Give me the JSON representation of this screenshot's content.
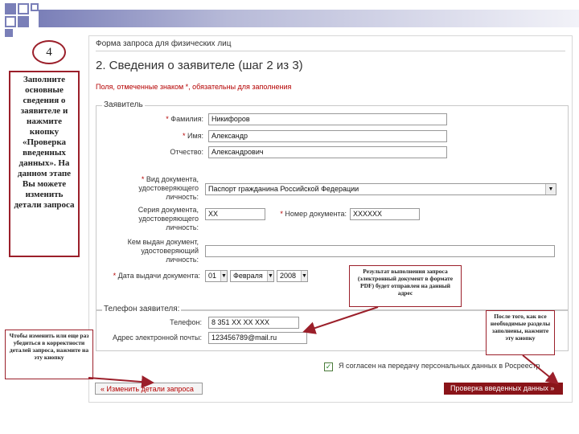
{
  "step_number": "4",
  "left_instruction": "Заполните основные сведения о заявителе и нажмите кнопку «Проверка введенных данных». На данном этапе Вы можете изменить детали запроса",
  "form": {
    "breadcrumb": "Форма запроса для физических лиц",
    "heading": "2. Сведения о заявителе (шаг 2 из 3)",
    "required_note": "Поля, отмеченные знаком *, обязательны для заполнения"
  },
  "applicant": {
    "legend": "Заявитель",
    "surname_label": "Фамилия:",
    "surname_value": "Никифоров",
    "name_label": "Имя:",
    "name_value": "Александр",
    "patronymic_label": "Отчество:",
    "patronymic_value": "Александрович",
    "doc_type_label_line1": "Вид документа,",
    "doc_type_label_line2": "удостоверяющего",
    "doc_type_label_line3": "личность:",
    "doc_type_value": "Паспорт гражданина Российской Федерации",
    "doc_series_label_line1": "Серия документа,",
    "doc_series_label_line2": "удостоверяющего",
    "doc_series_label_line3": "личность:",
    "doc_series_value": "XX",
    "doc_number_label": "Номер документа:",
    "doc_number_value": "XXXXXX",
    "issued_by_label_line1": "Кем выдан документ,",
    "issued_by_label_line2": "удостоверяющий",
    "issued_by_label_line3": "личность:",
    "issue_date_label": "Дата выдачи документа:",
    "issue_day": "01",
    "issue_month": "Февраля",
    "issue_year": "2008"
  },
  "contacts": {
    "legend": "Телефон заявителя:",
    "phone_label": "Телефон:",
    "phone_value": "8 351 XX XX XXX",
    "email_label": "Адрес электронной почты:",
    "email_value": "123456789@mail.ru"
  },
  "consent_label": "Я согласен на передачу персональных данных в Росреестр",
  "back_button": "« Изменить детали запроса",
  "next_button": "Проверка введенных данных »",
  "callouts": {
    "result": "Результат выполнения запроса (электронный документ в формате PDF) будет отправлен на данный адрес",
    "after": "После того, как все необходимые разделы заполнены, нажмите эту кнопку",
    "change": "Чтобы изменить или еще раз убедиться в корректности деталей запроса, нажмите на эту кнопку"
  },
  "colors": {
    "accent": "#9b1f2a",
    "deco": "#7a7fb8",
    "button": "#8a1419",
    "required": "#b50000"
  }
}
